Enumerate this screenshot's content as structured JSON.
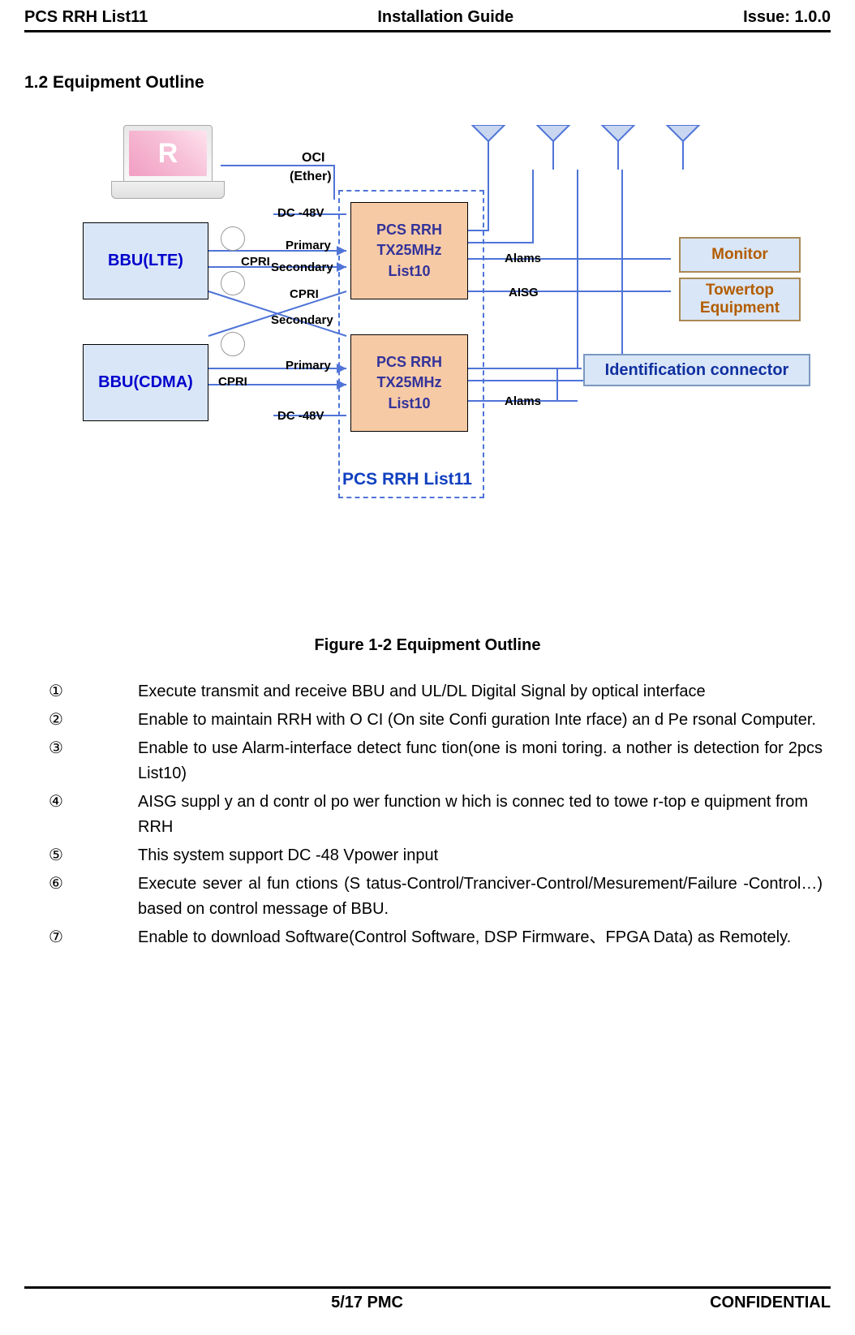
{
  "header": {
    "left": "PCS RRH List11",
    "center": "Installation Guide",
    "right": "Issue: 1.0.0"
  },
  "section_title": "1.2 Equipment  Outline",
  "diagram": {
    "laptop_glyph": "R",
    "bbu_lte": "BBU(LTE)",
    "bbu_cdma": "BBU(CDMA)",
    "rrh_line1": "PCS RRH",
    "rrh_line2": "TX25MHz",
    "rrh_line3": "List10",
    "labels": {
      "oci1": "OCI",
      "oci2": "(Ether)",
      "dc48_top": "DC -48V",
      "primary_top": "Primary",
      "secondary_top": "Secondary",
      "cpri_top": "CPRI",
      "cpri_mid": "CPRI",
      "secondary_bot": "Secondary",
      "primary_bot": "Primary",
      "cpri_bot": "CPRI",
      "dc48_bot": "DC -48V",
      "alams_top": "Alams",
      "aisg": "AISG",
      "alams_bot": "Alams"
    },
    "side": {
      "monitor": "Monitor",
      "towertop1": "Towertop",
      "towertop2": "Equipment",
      "ident": "Identification connector"
    },
    "dashed_caption": "PCS RRH List11"
  },
  "figure_caption": "Figure 1-2 Equipment Outline",
  "features": [
    {
      "num": "①",
      "text": "Execute transmit and receive BBU and UL/DL Digital Signal by optical interface"
    },
    {
      "num": "②",
      "text": "Enable to   maintain  RRH  with O CI (On site   Confi guration Inte rface) an d Pe rsonal Computer."
    },
    {
      "num": "③",
      "text": "Enable to  use Alarm-interface  detect func tion(one  is moni toring. a nother is  detection for 2pcs List10)"
    },
    {
      "num": "④",
      "text": "AISG suppl y an d contr ol po wer function w hich is connec ted to towe r-top e quipment from\nRRH"
    },
    {
      "num": "⑤",
      "text": "This system support    DC -48 Vpower input"
    },
    {
      "num": "⑥",
      "text": "Execute sever   al fun   ctions (S   tatus-Control/Tranciver-Control/Mesurement/Failure -Control…) based on control message of BBU."
    },
    {
      "num": "⑦",
      "text": "Enable to download Software(Control Software, DSP Firmware、FPGA Data) as Remotely."
    }
  ],
  "footer": {
    "center": "5/17 PMC",
    "right": "CONFIDENTIAL"
  }
}
